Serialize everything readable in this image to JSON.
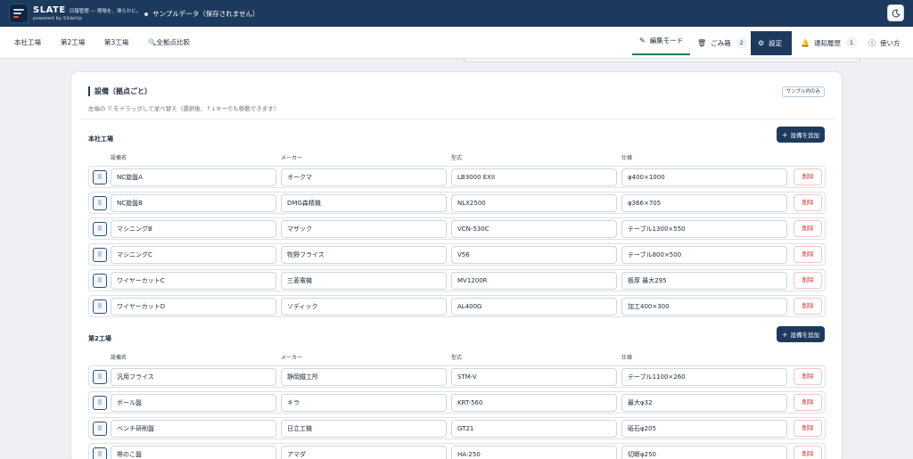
{
  "header": {
    "app_name": "SLATE",
    "tagline": "日報管理 — 現場を、滑らかに。",
    "powered_by": "powered by SlideUp",
    "status": "サンプルデータ（保存されません）",
    "theme_icon": "moon-icon"
  },
  "nav": {
    "left": [
      "本社工場",
      "第2工場",
      "第3工場",
      "全拠点比較"
    ],
    "compare_icon": "search-icon",
    "edit_mode": "編集モード",
    "trash": "ごみ箱",
    "trash_count": "2",
    "settings": "設定",
    "history": "通知履歴",
    "history_count": "1",
    "help": "使い方"
  },
  "section": {
    "title": "設備（拠点ごと）",
    "badge": "サンプル内のみ",
    "hint": "左端の ⠿ をドラッグして並べ替え（選択後、↑↓キーでも移動できます）"
  },
  "columns": [
    "設備名",
    "メーカー",
    "型式",
    "仕様"
  ],
  "add_label": "設備を追加",
  "delete_label": "削除",
  "accent": "#1d3a5e",
  "groups": [
    {
      "name": "本社工場",
      "rows": [
        {
          "name": "NC旋盤A",
          "maker": "オークマ",
          "model": "LB3000 EXII",
          "spec": "φ400×1000"
        },
        {
          "name": "NC旋盤B",
          "maker": "DMG森精機",
          "model": "NLX2500",
          "spec": "φ366×705"
        },
        {
          "name": "マシニングB",
          "maker": "マザック",
          "model": "VCN-530C",
          "spec": "テーブル1300×550"
        },
        {
          "name": "マシニングC",
          "maker": "牧野フライス",
          "model": "V56",
          "spec": "テーブル800×500"
        },
        {
          "name": "ワイヤーカットC",
          "maker": "三菱電機",
          "model": "MV1200R",
          "spec": "板厚 最大295"
        },
        {
          "name": "ワイヤーカットD",
          "maker": "ソディック",
          "model": "AL400G",
          "spec": "加工400×300"
        }
      ]
    },
    {
      "name": "第2工場",
      "rows": [
        {
          "name": "汎用フライス",
          "maker": "静岡鐵工所",
          "model": "STM-V",
          "spec": "テーブル1100×260"
        },
        {
          "name": "ボール盤",
          "maker": "キラ",
          "model": "KRT-560",
          "spec": "最大φ32"
        },
        {
          "name": "ベンチ研削盤",
          "maker": "日立工機",
          "model": "GT21",
          "spec": "砥石φ205"
        },
        {
          "name": "帯のこ盤",
          "maker": "アマダ",
          "model": "HA-250",
          "spec": "切断φ250"
        }
      ]
    }
  ]
}
